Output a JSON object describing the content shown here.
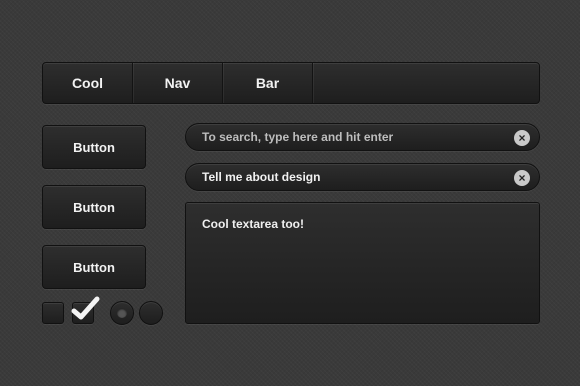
{
  "nav": {
    "items": [
      {
        "label": "Cool"
      },
      {
        "label": "Nav"
      },
      {
        "label": "Bar"
      }
    ]
  },
  "buttons": [
    {
      "label": "Button"
    },
    {
      "label": "Button"
    },
    {
      "label": "Button"
    }
  ],
  "search": {
    "placeholder": "To search, type here and hit enter",
    "value": ""
  },
  "second_input": {
    "value": "Tell me about design"
  },
  "textarea": {
    "value": "Cool textarea too!"
  },
  "checkboxes": [
    {
      "checked": false
    },
    {
      "checked": true
    }
  ],
  "radios": [
    {
      "selected": true
    },
    {
      "selected": false
    }
  ],
  "icons": {
    "clear": "close-circle-icon",
    "check": "checkmark-icon"
  },
  "colors": {
    "background": "#3a3a3a",
    "control": "#222222",
    "text": "#f2f2f2",
    "placeholder": "#bdbdbd"
  }
}
